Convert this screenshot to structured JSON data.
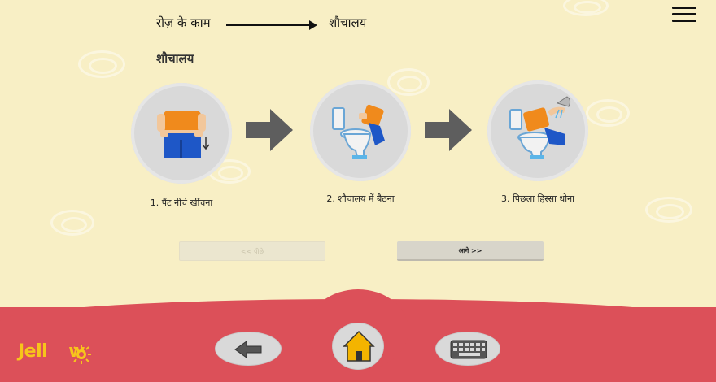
{
  "breadcrumb": {
    "parent": "रोज़ के काम",
    "current": "शौचालय"
  },
  "page_title": "शौचालय",
  "steps": [
    {
      "label": "1. पैंट नीचे खींचना",
      "icon": "pull-down-pants-icon"
    },
    {
      "label": "2. शौचालय में बैठना",
      "icon": "sit-on-toilet-icon"
    },
    {
      "label": "3. पिछला हिस्सा धोना",
      "icon": "wash-back-icon"
    }
  ],
  "nav": {
    "prev_label": "<< पीछे",
    "next_label": "आगे >>"
  },
  "brand": {
    "logo_text_a": "Jell",
    "logo_text_b": "w"
  },
  "colors": {
    "background": "#f8efc5",
    "bottom_bar": "#dc5059",
    "logo": "#f7c51b",
    "home_icon": "#f4b400"
  }
}
